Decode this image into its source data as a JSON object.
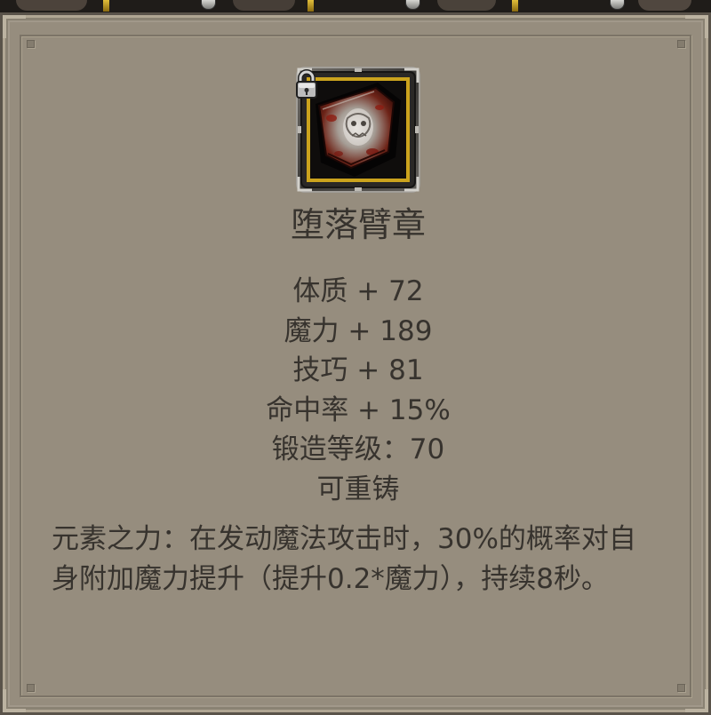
{
  "tooltip": {
    "item": {
      "name": "堕落臂章",
      "icon": "armband-icon",
      "locked": true,
      "lock_icon": "padlock-icon"
    },
    "stats": [
      "体质 + 72",
      "魔力 + 189",
      "技巧 + 81",
      "命中率 + 15%",
      "锻造等级：70",
      "可重铸"
    ],
    "description": [
      "元素之力：在发动魔法攻击时，30%的概率对自",
      "身附加魔力提升（提升0.2*魔力），持续8秒。"
    ]
  },
  "colors": {
    "panel_background": "#968d7e",
    "text": "#37332e",
    "icon_border_gold": "#cba31d",
    "icon_background": "#0f0d0c"
  }
}
